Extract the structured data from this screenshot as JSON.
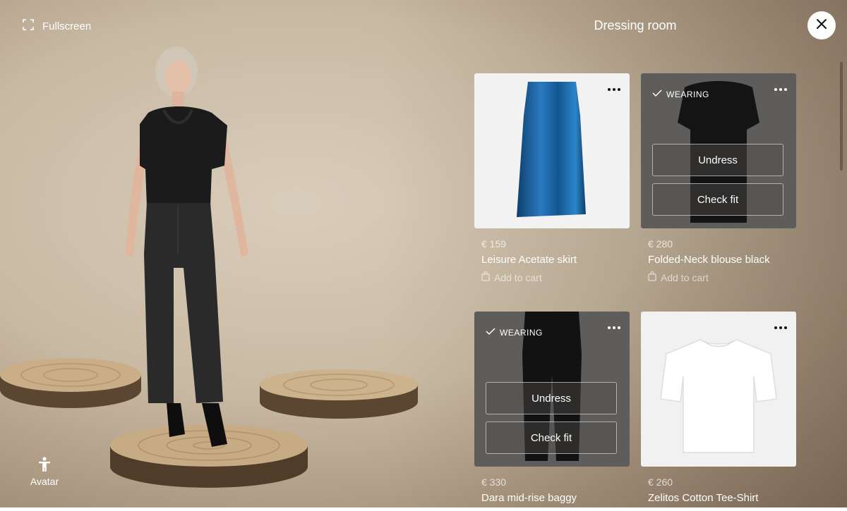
{
  "header": {
    "fullscreen_label": "Fullscreen",
    "title": "Dressing room"
  },
  "avatar": {
    "label": "Avatar"
  },
  "products": [
    {
      "price": "€ 159",
      "name": "Leisure Acetate skirt",
      "add_to_cart": "Add to cart",
      "wearing": false,
      "color": "#1c5f96"
    },
    {
      "price": "€ 280",
      "name": "Folded-Neck blouse black",
      "add_to_cart": "Add to cart",
      "wearing": true,
      "wearing_label": "WEARING",
      "undress_label": "Undress",
      "check_fit_label": "Check fit",
      "color": "#141414"
    },
    {
      "price": "€ 330",
      "name": "Dara mid-rise baggy",
      "wearing": true,
      "wearing_label": "WEARING",
      "undress_label": "Undress",
      "check_fit_label": "Check fit",
      "color": "#151515"
    },
    {
      "price": "€ 260",
      "name": "Zelitos Cotton Tee-Shirt",
      "wearing": false,
      "color": "#ffffff"
    }
  ],
  "colors": {
    "background": "#c8b9a2",
    "card_overlay": "#5f5d5b",
    "close_button": "#ffffff"
  }
}
